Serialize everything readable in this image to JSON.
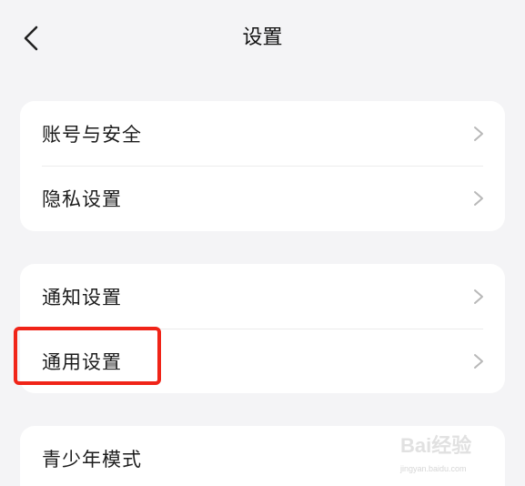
{
  "header": {
    "title": "设置",
    "back_icon": "chevron-left-icon"
  },
  "groups": [
    {
      "items": [
        {
          "label": "账号与安全",
          "icon": "chevron-right-icon"
        },
        {
          "label": "隐私设置",
          "icon": "chevron-right-icon"
        }
      ]
    },
    {
      "items": [
        {
          "label": "通知设置",
          "icon": "chevron-right-icon"
        },
        {
          "label": "通用设置",
          "icon": "chevron-right-icon"
        }
      ]
    },
    {
      "items": [
        {
          "label": "青少年模式",
          "icon": "chevron-right-icon"
        }
      ]
    }
  ],
  "annotation": {
    "highlight_color": "#f02418",
    "highlighted_item": "通用设置"
  },
  "watermark": {
    "main": "Bai经验",
    "sub": "jingyan.baidu.com"
  },
  "colors": {
    "background": "#f4f4f6",
    "card": "#ffffff",
    "chevron": "#b8b8b8"
  }
}
